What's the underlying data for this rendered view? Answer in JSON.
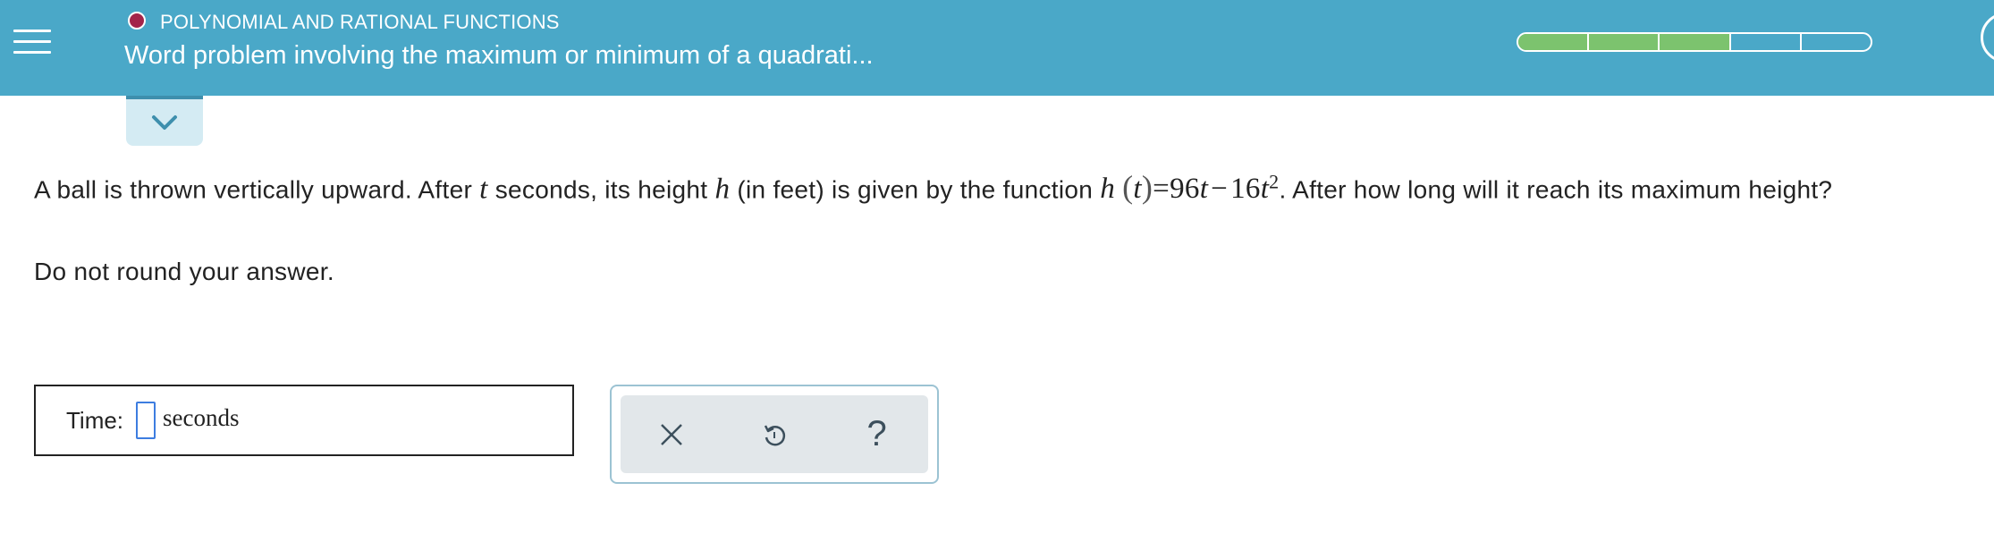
{
  "header": {
    "topic": "POLYNOMIAL AND RATIONAL FUNCTIONS",
    "title": "Word problem involving the maximum or minimum of a quadrati...",
    "progress": {
      "filled": 3,
      "total": 5
    },
    "colors": {
      "bar": "#4aa8c8",
      "topic_dot": "#a3244a",
      "progress_fill": "#7cc36e"
    },
    "menu_icon": "hamburger-icon"
  },
  "collapse_icon": "chevron-down-icon",
  "question": {
    "part1": "A ball is thrown vertically upward. After",
    "var_t": "t",
    "part2": "seconds, its height",
    "var_h": "h",
    "part3": "(in feet) is given by the function",
    "func_name": "h",
    "open_paren": "(",
    "func_arg": "t",
    "close_paren": ")",
    "equals": "=",
    "coef1": "96",
    "var_t2": "t",
    "minus": "−",
    "coef2": "16",
    "var_t3": "t",
    "exponent": "2",
    "part4": ". After how long will it reach its maximum height?"
  },
  "instruction": "Do not round your answer.",
  "answer": {
    "label": "Time:",
    "value": "",
    "unit": "seconds"
  },
  "tools": {
    "clear_icon": "close-icon",
    "undo_icon": "undo-icon",
    "help_icon": "help-icon",
    "clear_symbol": "×",
    "help_symbol": "?"
  }
}
